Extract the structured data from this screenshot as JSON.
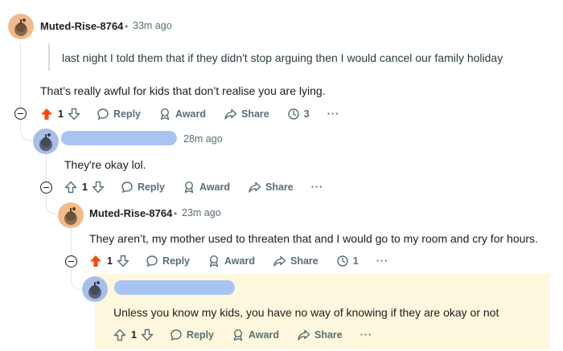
{
  "colors": {
    "upvote_active": "#ff4500",
    "highlight_bg": "#fdf7dd",
    "redacted": "#a8c4f3"
  },
  "comments": [
    {
      "username": "Muted-Rise-8764",
      "time": "33m ago",
      "quote": "last night I told them that if they didn't stop arguing then I would cancel our family holiday",
      "body": "That’s really awful for kids that don’t realise you are lying.",
      "votes": "1",
      "upvoted": true,
      "reply_label": "Reply",
      "award_label": "Award",
      "share_label": "Share",
      "replies_count": "3"
    },
    {
      "time": "28m ago",
      "body": "They're okay lol.",
      "votes": "1",
      "upvoted": false,
      "reply_label": "Reply",
      "award_label": "Award",
      "share_label": "Share"
    },
    {
      "username": "Muted-Rise-8764",
      "time": "23m ago",
      "body": "They aren’t, my mother used to threaten that and I would go to my room and cry for hours.",
      "votes": "1",
      "upvoted": true,
      "reply_label": "Reply",
      "award_label": "Award",
      "share_label": "Share",
      "replies_count": "1"
    },
    {
      "body": "Unless you know my kids, you have no way of knowing if they are okay or not",
      "votes": "1",
      "upvoted": false,
      "reply_label": "Reply",
      "award_label": "Award",
      "share_label": "Share"
    }
  ],
  "more_label": "···",
  "separator": "•"
}
